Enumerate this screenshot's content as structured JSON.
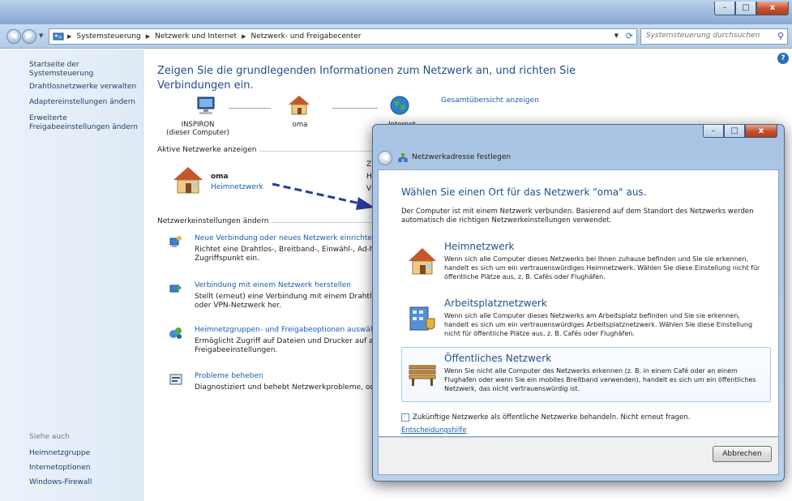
{
  "window": {
    "minimize": "–",
    "maximize": "□",
    "close": "x"
  },
  "address": {
    "breadcrumbs": [
      "Systemsteuerung",
      "Netzwerk und Internet",
      "Netzwerk- und Freigabecenter"
    ],
    "search_placeholder": "Systemsteuerung durchsuchen"
  },
  "sidebar": {
    "items": [
      "Startseite der Systemsteuerung",
      "Drahtlosnetzwerke verwalten",
      "Adaptereinstellungen ändern",
      "Erweiterte\nFreigabeeinstellungen ändern"
    ],
    "see_also_heading": "Siehe auch",
    "see_also": [
      "Heimnetzgruppe",
      "Internetoptionen",
      "Windows-Firewall"
    ]
  },
  "main": {
    "title": "Zeigen Sie die grundlegenden Informationen zum Netzwerk an, und richten Sie Verbindungen ein.",
    "full_map_link": "Gesamtübersicht anzeigen",
    "nodes": {
      "computer_name": "INSPIRON",
      "computer_sub": "(dieser Computer)",
      "network_name": "oma",
      "internet": "Internet"
    },
    "active_networks_label": "Aktive Netzwerke anzeigen",
    "active_network": {
      "name": "oma",
      "type": "Heimnetzwerk",
      "cut_letters": [
        "Z",
        "H",
        "V"
      ]
    },
    "settings_label": "Netzwerkeinstellungen ändern",
    "tasks": [
      {
        "link": "Neue Verbindung oder neues Netzwerk einrichten",
        "desc": "Richtet eine Drahtlos-, Breitband-, Einwähl-, Ad-ho\nZugriffspunkt ein."
      },
      {
        "link": "Verbindung mit einem Netzwerk herstellen",
        "desc": "Stellt (erneut) eine Verbindung mit einem Drahtlos\noder VPN-Netzwerk her."
      },
      {
        "link": "Heimnetzgruppen- und Freigabeoptionen auswähl",
        "desc": "Ermöglicht Zugriff auf Dateien und Drucker auf an\nFreigabeeinstellungen."
      },
      {
        "link": "Probleme beheben",
        "desc": "Diagnostiziert und behebt Netzwerkprobleme, ode"
      }
    ]
  },
  "dialog": {
    "title": "Netzwerkadresse festlegen",
    "heading": "Wählen Sie einen Ort für das Netzwerk \"oma\" aus.",
    "intro": "Der Computer ist mit einem Netzwerk verbunden. Basierend auf dem Standort des Netzwerks werden automatisch die richtigen Netzwerkeinstellungen verwendet.",
    "options": [
      {
        "title": "Heimnetzwerk",
        "desc": "Wenn sich alle Computer dieses Netzwerks bei Ihnen zuhause befinden und Sie sie erkennen, handelt es sich um ein vertrauenswürdiges Heimnetzwerk. Wählen Sie diese Einstellung nicht für öffentliche Plätze aus, z. B. Cafés oder Flughäfen."
      },
      {
        "title": "Arbeitsplatznetzwerk",
        "desc": "Wenn sich alle Computer dieses Netzwerks am Arbeitsplatz befinden und Sie sie erkennen, handelt es sich um ein vertrauenswürdiges Arbeitsplatznetzwerk. Wählen Sie diese Einstellung nicht für öffentliche Plätze aus, z. B. Cafés oder Flughäfen."
      },
      {
        "title": "Öffentliches Netzwerk",
        "desc": "Wenn Sie nicht alle Computer des Netzwerks erkennen (z. B. in einem Café oder an einem Flughafen oder wenn Sie ein mobiles Breitband verwenden), handelt es sich um ein öffentliches Netzwerk, das nicht vertrauenswürdig ist."
      }
    ],
    "checkbox_label": "Zukünftige Netzwerke als öffentliche Netzwerke behandeln. Nicht erneut fragen.",
    "help_link": "Entscheidungshilfe",
    "cancel": "Abbrechen"
  }
}
